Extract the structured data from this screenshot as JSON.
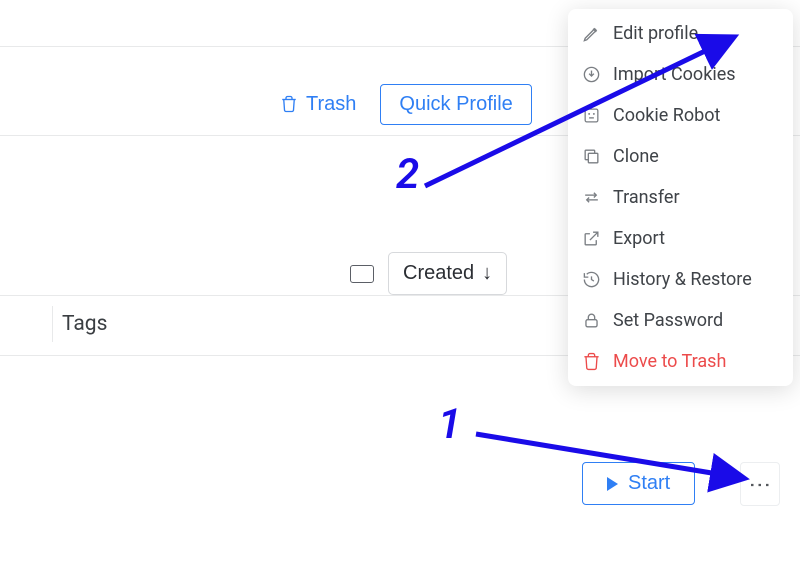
{
  "toolbar": {
    "trash_label": "Trash",
    "quick_profile_label": "Quick Profile"
  },
  "sort": {
    "created_label": "Created"
  },
  "columns": {
    "tags_header": "Tags"
  },
  "row_action": {
    "start_label": "Start"
  },
  "context_menu": {
    "items": [
      {
        "label": "Edit profile",
        "icon": "edit"
      },
      {
        "label": "Import Cookies",
        "icon": "import"
      },
      {
        "label": "Cookie Robot",
        "icon": "robot"
      },
      {
        "label": "Clone",
        "icon": "clone"
      },
      {
        "label": "Transfer",
        "icon": "transfer"
      },
      {
        "label": "Export",
        "icon": "export"
      },
      {
        "label": "History & Restore",
        "icon": "history"
      },
      {
        "label": "Set Password",
        "icon": "lock"
      },
      {
        "label": "Move to Trash",
        "icon": "trash",
        "danger": true
      }
    ]
  },
  "annotations": {
    "num1": "1",
    "num2": "2"
  }
}
